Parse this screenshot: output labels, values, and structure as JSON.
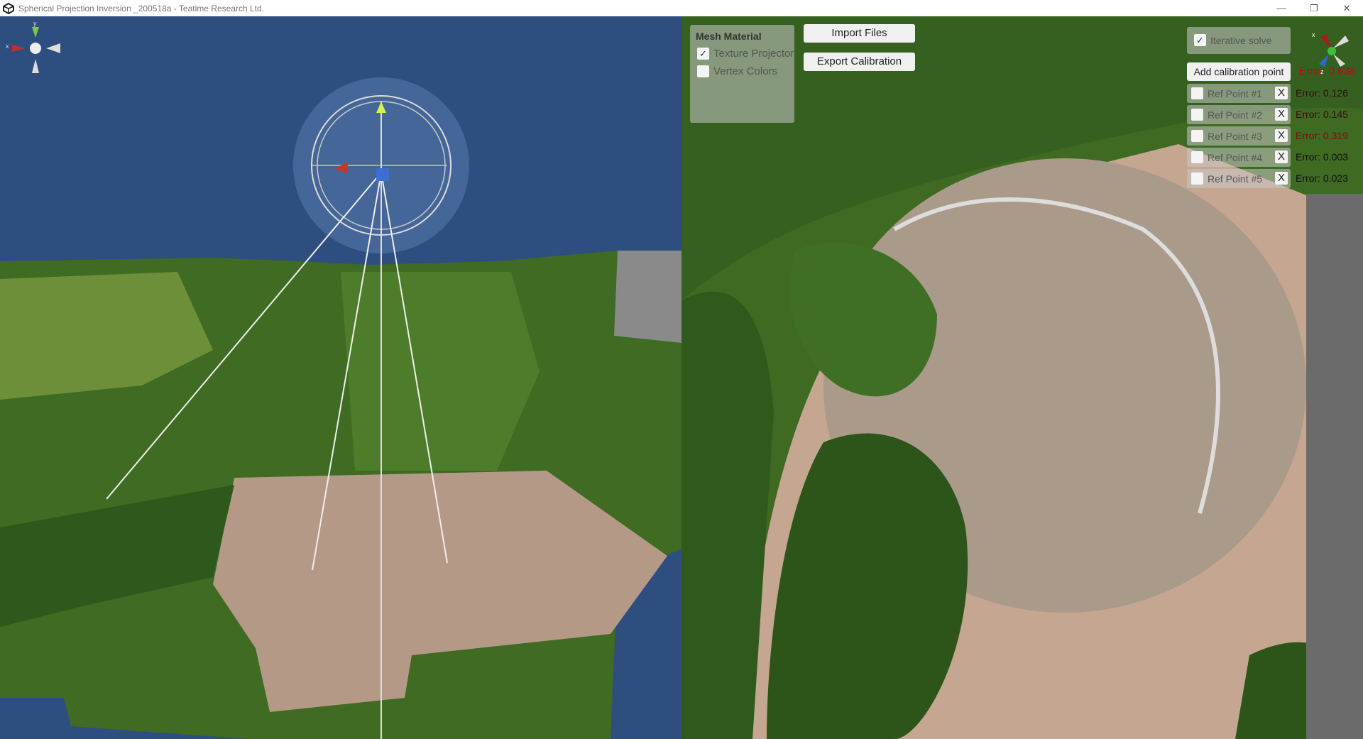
{
  "window": {
    "title": "Spherical Projection Inversion _200518a - Teatime Research Ltd.",
    "minimize": "—",
    "maximize": "❐",
    "close": "✕"
  },
  "gizmo_left": {
    "y_label": "y",
    "x_label": "x"
  },
  "mesh_material": {
    "title": "Mesh Material",
    "options": [
      {
        "label": "Texture Projector",
        "checked": true,
        "mark": "✓"
      },
      {
        "label": "Vertex Colors",
        "checked": false,
        "mark": ""
      }
    ]
  },
  "buttons": {
    "import": "Import Files",
    "export": "Export Calibration",
    "add_point": "Add calibration point"
  },
  "iterative": {
    "label": "Iterative solve",
    "checked": true,
    "mark": "✓"
  },
  "total_error": "Error: 0.638",
  "ref_points": [
    {
      "label": "Ref Point #1",
      "remove": "X",
      "error": "Error: 0.126",
      "error_color": "#3a0a0a"
    },
    {
      "label": "Ref Point #2",
      "remove": "X",
      "error": "Error: 0.145",
      "error_color": "#3a0a0a"
    },
    {
      "label": "Ref Point #3",
      "remove": "X",
      "error": "Error: 0.319",
      "error_color": "#7a1010"
    },
    {
      "label": "Ref Point #4",
      "remove": "X",
      "error": "Error: 0.003",
      "error_color": "#111111"
    },
    {
      "label": "Ref Point #5",
      "remove": "X",
      "error": "Error: 0.023",
      "error_color": "#111111"
    }
  ],
  "gizmo_right": {
    "x_label": "x",
    "z_label": "z"
  },
  "colors": {
    "viewport_bg": "#2e4e80",
    "error_total": "#b01010"
  }
}
